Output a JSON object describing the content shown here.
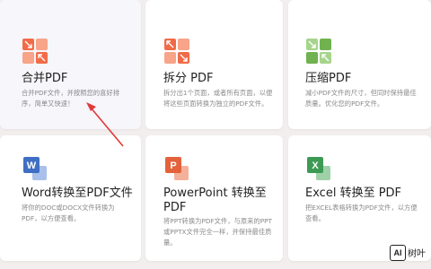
{
  "cards": [
    {
      "title": "合并PDF",
      "desc": "合并PDF文件，并按照您的喜好排序，简单又快速！",
      "icon": "merge-pdf-icon",
      "color": "#f26b48"
    },
    {
      "title": "拆分 PDF",
      "desc": "拆分出1个页面，或者所有页面，以便将这些页面转换为独立的PDF文件。",
      "icon": "split-pdf-icon",
      "color": "#f26b48"
    },
    {
      "title": "压缩PDF",
      "desc": "减小PDF文件的尺寸，但同时保持最佳质量。优化您的PDF文件。",
      "icon": "compress-pdf-icon",
      "color": "#6fb24f"
    },
    {
      "title": "Word转换至PDF文件",
      "desc": "将你的DOC或DOCX文件转换为PDF，以方便查看。",
      "icon": "word-icon",
      "color": "#3f6fc4",
      "letter": "W"
    },
    {
      "title": "PowerPoint 转换至 PDF",
      "desc": "将PPT转换为PDF文件，与原来的PPT或PPTX文件完全一样，并保持最佳质量。",
      "icon": "powerpoint-icon",
      "color": "#e3623b",
      "letter": "P"
    },
    {
      "title": "Excel 转换至 PDF",
      "desc": "把EXCEL表格转换为PDF文件，以方便查看。",
      "icon": "excel-icon",
      "color": "#3d9a54",
      "letter": "X"
    }
  ],
  "watermark": {
    "badge": "AI",
    "text": "树叶"
  }
}
